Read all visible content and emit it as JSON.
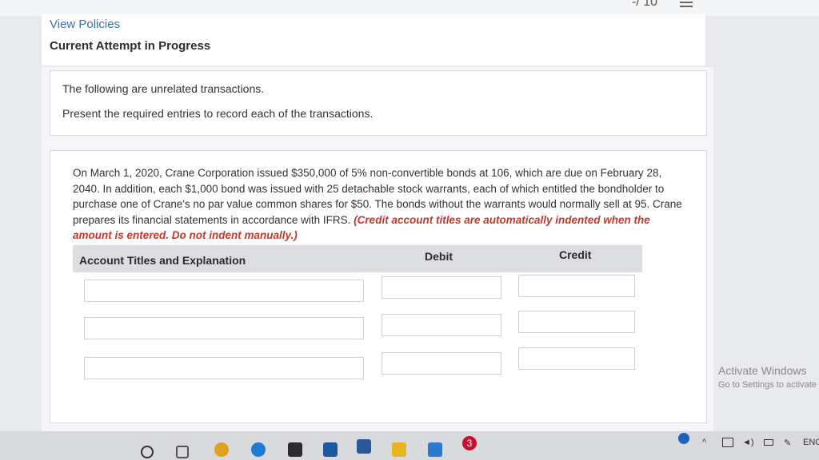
{
  "header": {
    "page_counter": "-/ 10",
    "view_policies": "View Policies",
    "attempt_status": "Current Attempt in Progress"
  },
  "intro": {
    "line1": "The following are unrelated transactions.",
    "line2": "Present the required entries to record each of the transactions."
  },
  "question": {
    "body": "On March 1, 2020, Crane Corporation issued $350,000 of 5% non-convertible bonds at 106, which are due on February 28, 2040. In addition, each $1,000 bond was issued with 25 detachable stock warrants, each of which entitled the bondholder to purchase one of Crane's no par value common shares for $50. The bonds without the warrants would normally sell at 95. Crane prepares its financial statements in accordance with IFRS.",
    "note": "(Credit account titles are automatically indented when the amount is entered. Do not indent manually.)"
  },
  "journal_table": {
    "col_account": "Account Titles and Explanation",
    "col_debit": "Debit",
    "col_credit": "Credit",
    "rows": [
      {
        "account": "",
        "debit": "",
        "credit": ""
      },
      {
        "account": "",
        "debit": "",
        "credit": ""
      },
      {
        "account": "",
        "debit": "",
        "credit": ""
      }
    ]
  },
  "watermark": {
    "line1": "Activate Windows",
    "line2": "Go to Settings to activate"
  },
  "taskbar": {
    "language": "ENG",
    "icons": [
      "start-circle-icon",
      "task-view-icon",
      "chrome-icon",
      "edge-icon",
      "store-icon",
      "mail-icon",
      "word-icon",
      "file-explorer-icon",
      "paint-icon",
      "notification-badge-icon"
    ],
    "badge_count": "3"
  },
  "colors": {
    "link": "#3a6fb0",
    "note_red": "#c0392b",
    "table_header_bg": "#dcdde1"
  }
}
